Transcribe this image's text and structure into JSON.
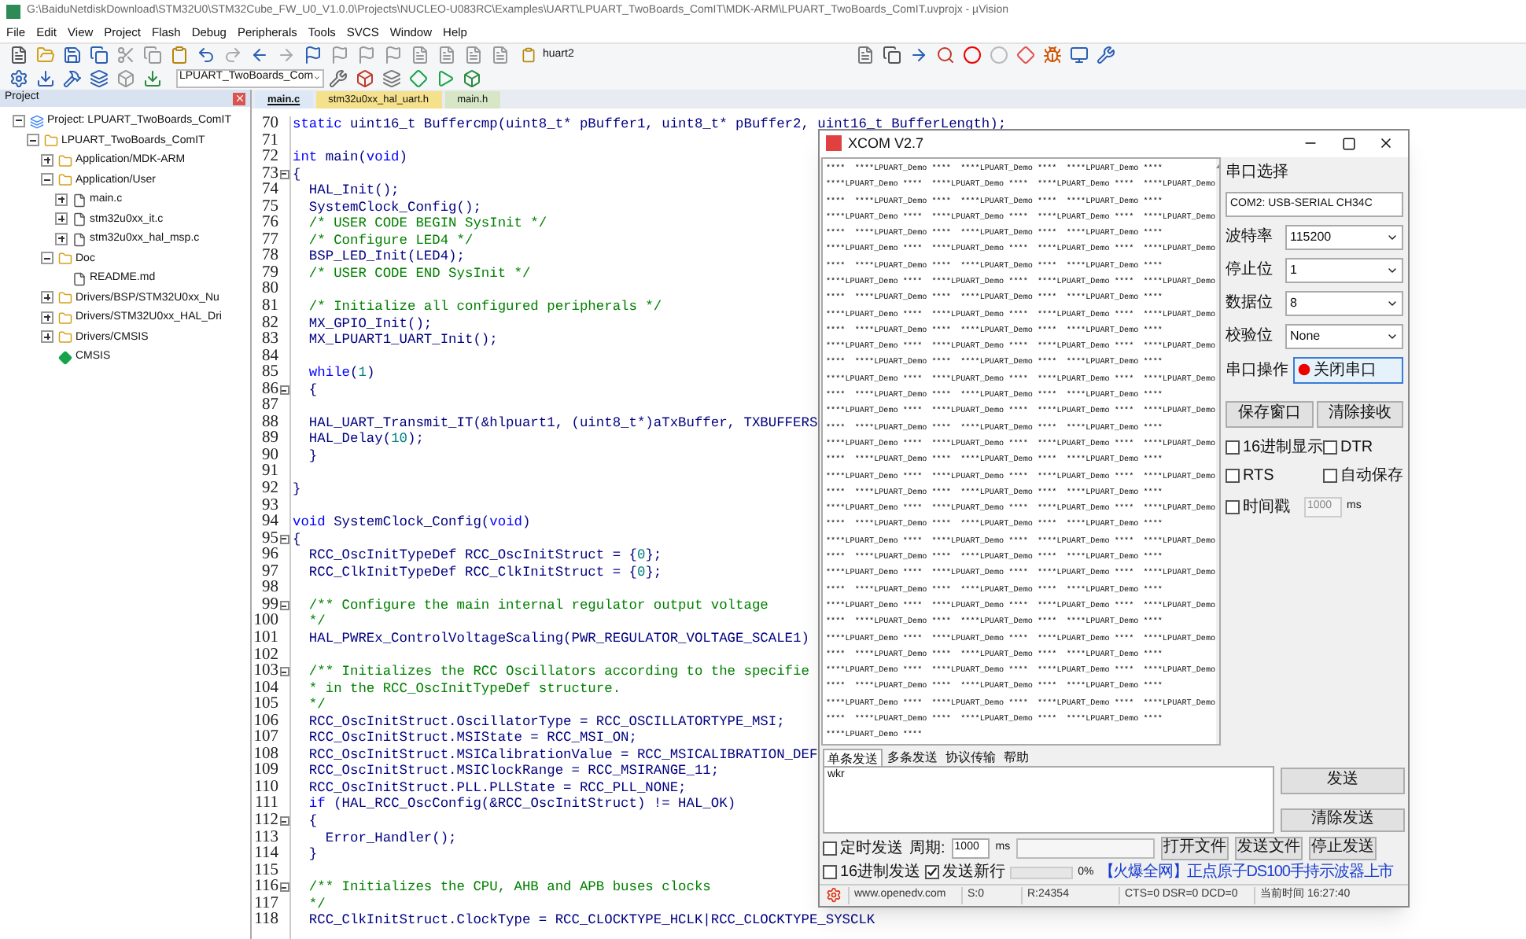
{
  "window": {
    "title": "G:\\BaiduNetdiskDownload\\STM32U0\\STM32Cube_FW_U0_V1.0.0\\Projects\\NUCLEO-U083RC\\Examples\\UART\\LPUART_TwoBoards_ComIT\\MDK-ARM\\LPUART_TwoBoards_ComIT.uvprojx - µVision"
  },
  "menu": [
    "File",
    "Edit",
    "View",
    "Project",
    "Flash",
    "Debug",
    "Peripherals",
    "Tools",
    "SVCS",
    "Window",
    "Help"
  ],
  "toolbar": {
    "find_value": "huart2",
    "target": "LPUART_TwoBoards_Com"
  },
  "project": {
    "title": "Project",
    "tree": [
      {
        "label": "Project: LPUART_TwoBoards_ComIT",
        "kind": "project",
        "expanded": true,
        "children": [
          {
            "label": "LPUART_TwoBoards_ComIT",
            "kind": "target",
            "expanded": true,
            "children": [
              {
                "label": "Application/MDK-ARM",
                "kind": "folder",
                "expanded": false
              },
              {
                "label": "Application/User",
                "kind": "folder",
                "expanded": true,
                "children": [
                  {
                    "label": "main.c",
                    "kind": "file",
                    "expanded": false
                  },
                  {
                    "label": "stm32u0xx_it.c",
                    "kind": "file",
                    "expanded": false
                  },
                  {
                    "label": "stm32u0xx_hal_msp.c",
                    "kind": "file",
                    "expanded": false
                  }
                ]
              },
              {
                "label": "Doc",
                "kind": "folder",
                "expanded": true,
                "children": [
                  {
                    "label": "README.md",
                    "kind": "file"
                  }
                ]
              },
              {
                "label": "Drivers/BSP/STM32U0xx_Nu",
                "kind": "folder",
                "expanded": false
              },
              {
                "label": "Drivers/STM32U0xx_HAL_Dri",
                "kind": "folder",
                "expanded": false
              },
              {
                "label": "Drivers/CMSIS",
                "kind": "folder",
                "expanded": false
              },
              {
                "label": "CMSIS",
                "kind": "component"
              }
            ]
          }
        ]
      }
    ]
  },
  "tabs": [
    {
      "label": "main.c",
      "selected": true,
      "color": "#dce8f5"
    },
    {
      "label": "stm32u0xx_hal_uart.h",
      "selected": false,
      "color": "#f5e08c"
    },
    {
      "label": "main.h",
      "selected": false,
      "color": "#d6e6c6"
    }
  ],
  "code": [
    {
      "n": "70",
      "parts": [
        {
          "kind": "keyword",
          "t": "static"
        },
        {
          "kind": "plain",
          "t": " uint16_t Buffercmp(uint8_t* pBuffer1, uint8_t* pBuffer2, uint16_t BufferLength);"
        }
      ]
    },
    {
      "n": "71"
    },
    {
      "n": "72",
      "parts": [
        {
          "kind": "keyword",
          "t": "int"
        },
        {
          "kind": "plain",
          "t": " main("
        },
        {
          "kind": "keyword",
          "t": "void"
        },
        {
          "kind": "plain",
          "t": ")"
        }
      ]
    },
    {
      "n": "73",
      "fold": true,
      "parts": [
        {
          "kind": "plain",
          "t": "{"
        }
      ]
    },
    {
      "n": "74",
      "parts": [
        {
          "kind": "plain",
          "t": "  HAL_Init();"
        }
      ]
    },
    {
      "n": "75",
      "parts": [
        {
          "kind": "plain",
          "t": "  SystemClock_Config();"
        }
      ]
    },
    {
      "n": "76",
      "parts": [
        {
          "kind": "comment",
          "t": "  /* USER CODE BEGIN SysInit */"
        }
      ]
    },
    {
      "n": "77",
      "parts": [
        {
          "kind": "comment",
          "t": "  /* Configure LED4 */"
        }
      ]
    },
    {
      "n": "78",
      "parts": [
        {
          "kind": "plain",
          "t": "  BSP_LED_Init(LED4);"
        }
      ]
    },
    {
      "n": "79",
      "parts": [
        {
          "kind": "comment",
          "t": "  /* USER CODE END SysInit */"
        }
      ]
    },
    {
      "n": "80"
    },
    {
      "n": "81",
      "parts": [
        {
          "kind": "comment",
          "t": "  /* Initialize all configured peripherals */"
        }
      ]
    },
    {
      "n": "82",
      "parts": [
        {
          "kind": "plain",
          "t": "  MX_GPIO_Init();"
        }
      ]
    },
    {
      "n": "83",
      "parts": [
        {
          "kind": "plain",
          "t": "  MX_LPUART1_UART_Init();"
        }
      ]
    },
    {
      "n": "84"
    },
    {
      "n": "85",
      "parts": [
        {
          "kind": "keyword",
          "t": "  while"
        },
        {
          "kind": "plain",
          "t": "("
        },
        {
          "kind": "number",
          "t": "1"
        },
        {
          "kind": "plain",
          "t": ")"
        }
      ]
    },
    {
      "n": "86",
      "fold": true,
      "parts": [
        {
          "kind": "plain",
          "t": "  {"
        }
      ]
    },
    {
      "n": "87"
    },
    {
      "n": "88",
      "parts": [
        {
          "kind": "plain",
          "t": "  HAL_UART_Transmit_IT(&hlpuart1, (uint8_t*)aTxBuffer, TXBUFFERS"
        }
      ]
    },
    {
      "n": "89",
      "parts": [
        {
          "kind": "plain",
          "t": "  HAL_Delay("
        },
        {
          "kind": "number",
          "t": "10"
        },
        {
          "kind": "plain",
          "t": ");"
        }
      ]
    },
    {
      "n": "90",
      "parts": [
        {
          "kind": "plain",
          "t": "  }"
        }
      ]
    },
    {
      "n": "91"
    },
    {
      "n": "92",
      "parts": [
        {
          "kind": "plain",
          "t": "}"
        }
      ]
    },
    {
      "n": "93"
    },
    {
      "n": "94",
      "parts": [
        {
          "kind": "keyword",
          "t": "void"
        },
        {
          "kind": "plain",
          "t": " SystemClock_Config("
        },
        {
          "kind": "keyword",
          "t": "void"
        },
        {
          "kind": "plain",
          "t": ")"
        }
      ]
    },
    {
      "n": "95",
      "fold": true,
      "parts": [
        {
          "kind": "plain",
          "t": "{"
        }
      ]
    },
    {
      "n": "96",
      "parts": [
        {
          "kind": "plain",
          "t": "  RCC_OscInitTypeDef RCC_OscInitStruct = {"
        },
        {
          "kind": "number",
          "t": "0"
        },
        {
          "kind": "plain",
          "t": "};"
        }
      ]
    },
    {
      "n": "97",
      "parts": [
        {
          "kind": "plain",
          "t": "  RCC_ClkInitTypeDef RCC_ClkInitStruct = {"
        },
        {
          "kind": "number",
          "t": "0"
        },
        {
          "kind": "plain",
          "t": "};"
        }
      ]
    },
    {
      "n": "98"
    },
    {
      "n": "99",
      "fold": true,
      "parts": [
        {
          "kind": "comment",
          "t": "  /** Configure the main internal regulator output voltage"
        }
      ]
    },
    {
      "n": "100",
      "parts": [
        {
          "kind": "comment",
          "t": "  */"
        }
      ]
    },
    {
      "n": "101",
      "parts": [
        {
          "kind": "plain",
          "t": "  HAL_PWREx_ControlVoltageScaling(PWR_REGULATOR_VOLTAGE_SCALE1)"
        }
      ]
    },
    {
      "n": "102"
    },
    {
      "n": "103",
      "fold": true,
      "parts": [
        {
          "kind": "comment",
          "t": "  /** Initializes the RCC Oscillators according to the specifie"
        }
      ]
    },
    {
      "n": "104",
      "parts": [
        {
          "kind": "comment",
          "t": "  * in the RCC_OscInitTypeDef structure."
        }
      ]
    },
    {
      "n": "105",
      "parts": [
        {
          "kind": "comment",
          "t": "  */"
        }
      ]
    },
    {
      "n": "106",
      "parts": [
        {
          "kind": "plain",
          "t": "  RCC_OscInitStruct.OscillatorType = RCC_OSCILLATORTYPE_MSI;"
        }
      ]
    },
    {
      "n": "107",
      "parts": [
        {
          "kind": "plain",
          "t": "  RCC_OscInitStruct.MSIState = RCC_MSI_ON;"
        }
      ]
    },
    {
      "n": "108",
      "parts": [
        {
          "kind": "plain",
          "t": "  RCC_OscInitStruct.MSICalibrationValue = RCC_MSICALIBRATION_DEF"
        }
      ]
    },
    {
      "n": "109",
      "parts": [
        {
          "kind": "plain",
          "t": "  RCC_OscInitStruct.MSIClockRange = RCC_MSIRANGE_11;"
        }
      ]
    },
    {
      "n": "110",
      "parts": [
        {
          "kind": "plain",
          "t": "  RCC_OscInitStruct.PLL.PLLState = RCC_PLL_NONE;"
        }
      ]
    },
    {
      "n": "111",
      "parts": [
        {
          "kind": "keyword",
          "t": "  if"
        },
        {
          "kind": "plain",
          "t": " (HAL_RCC_OscConfig(&RCC_OscInitStruct) != HAL_OK)"
        }
      ]
    },
    {
      "n": "112",
      "fold": true,
      "parts": [
        {
          "kind": "plain",
          "t": "  {"
        }
      ]
    },
    {
      "n": "113",
      "parts": [
        {
          "kind": "plain",
          "t": "    Error_Handler();"
        }
      ]
    },
    {
      "n": "114",
      "parts": [
        {
          "kind": "plain",
          "t": "  }"
        }
      ]
    },
    {
      "n": "115"
    },
    {
      "n": "116",
      "fold": true,
      "parts": [
        {
          "kind": "comment",
          "t": "  /** Initializes the CPU, AHB and APB buses clocks"
        }
      ]
    },
    {
      "n": "117",
      "parts": [
        {
          "kind": "comment",
          "t": "  */"
        }
      ]
    },
    {
      "n": "118",
      "parts": [
        {
          "kind": "plain",
          "t": "  RCC_ClkInitStruct.ClockType = RCC_CLOCKTYPE_HCLK|RCC_CLOCKTYPE_SYSCLK"
        }
      ]
    }
  ],
  "xcom": {
    "title": "XCOM V2.7",
    "receive": [
      "****  ****LPUART_Demo ****  ****LPUART_Demo ****  ****LPUART_Demo ****",
      "****LPUART_Demo ****  ****LPUART_Demo ****  ****LPUART_Demo ****  ****LPUART_Demo",
      "****  ****LPUART_Demo ****  ****LPUART_Demo ****  ****LPUART_Demo ****",
      "****LPUART_Demo ****  ****LPUART_Demo ****  ****LPUART_Demo ****  ****LPUART_Demo",
      "****  ****LPUART_Demo ****  ****LPUART_Demo ****  ****LPUART_Demo ****",
      "****LPUART_Demo ****  ****LPUART_Demo ****  ****LPUART_Demo ****  ****LPUART_Demo",
      "****  ****LPUART_Demo ****  ****LPUART_Demo ****  ****LPUART_Demo ****",
      "****LPUART_Demo ****  ****LPUART_Demo ****  ****LPUART_Demo ****  ****LPUART_Demo",
      "****  ****LPUART_Demo ****  ****LPUART_Demo ****  ****LPUART_Demo ****",
      "****LPUART_Demo ****  ****LPUART_Demo ****  ****LPUART_Demo ****  ****LPUART_Demo",
      "****  ****LPUART_Demo ****  ****LPUART_Demo ****  ****LPUART_Demo ****",
      "****LPUART_Demo ****  ****LPUART_Demo ****  ****LPUART_Demo ****  ****LPUART_Demo",
      "****  ****LPUART_Demo ****  ****LPUART_Demo ****  ****LPUART_Demo ****",
      "****LPUART_Demo ****  ****LPUART_Demo ****  ****LPUART_Demo ****  ****LPUART_Demo",
      "****  ****LPUART_Demo ****  ****LPUART_Demo ****  ****LPUART_Demo ****",
      "****LPUART_Demo ****  ****LPUART_Demo ****  ****LPUART_Demo ****  ****LPUART_Demo",
      "****  ****LPUART_Demo ****  ****LPUART_Demo ****  ****LPUART_Demo ****",
      "****LPUART_Demo ****  ****LPUART_Demo ****  ****LPUART_Demo ****  ****LPUART_Demo",
      "****  ****LPUART_Demo ****  ****LPUART_Demo ****  ****LPUART_Demo ****",
      "****LPUART_Demo ****  ****LPUART_Demo ****  ****LPUART_Demo ****  ****LPUART_Demo",
      "****  ****LPUART_Demo ****  ****LPUART_Demo ****  ****LPUART_Demo ****",
      "****LPUART_Demo ****  ****LPUART_Demo ****  ****LPUART_Demo ****  ****LPUART_Demo",
      "****  ****LPUART_Demo ****  ****LPUART_Demo ****  ****LPUART_Demo ****",
      "****LPUART_Demo ****  ****LPUART_Demo ****  ****LPUART_Demo ****  ****LPUART_Demo",
      "****  ****LPUART_Demo ****  ****LPUART_Demo ****  ****LPUART_Demo ****",
      "****LPUART_Demo ****  ****LPUART_Demo ****  ****LPUART_Demo ****  ****LPUART_Demo",
      "****  ****LPUART_Demo ****  ****LPUART_Demo ****  ****LPUART_Demo ****",
      "****LPUART_Demo ****  ****LPUART_Demo ****  ****LPUART_Demo ****  ****LPUART_Demo",
      "****  ****LPUART_Demo ****  ****LPUART_Demo ****  ****LPUART_Demo ****",
      "****LPUART_Demo ****  ****LPUART_Demo ****  ****LPUART_Demo ****  ****LPUART_Demo",
      "****  ****LPUART_Demo ****  ****LPUART_Demo ****  ****LPUART_Demo ****",
      "****LPUART_Demo ****  ****LPUART_Demo ****  ****LPUART_Demo ****  ****LPUART_Demo",
      "****  ****LPUART_Demo ****  ****LPUART_Demo ****  ****LPUART_Demo ****",
      "****LPUART_Demo ****  ****LPUART_Demo ****  ****LPUART_Demo ****  ****LPUART_Demo",
      "****  ****LPUART_Demo ****  ****LPUART_Demo ****  ****LPUART_Demo ****",
      "****LPUART_Demo ****"
    ],
    "port_label": "串口选择",
    "port": "COM2: USB-SERIAL CH34C",
    "settings": [
      {
        "label": "波特率",
        "value": "115200"
      },
      {
        "label": "停止位",
        "value": "1"
      },
      {
        "label": "数据位",
        "value": "8"
      },
      {
        "label": "校验位",
        "value": "None"
      }
    ],
    "op_label": "串口操作",
    "op_button": "关闭串口",
    "save_button": "保存窗口",
    "clear_button": "清除接收",
    "options": [
      {
        "label": "16进制显示",
        "checked": false
      },
      {
        "label": "DTR",
        "checked": false
      },
      {
        "label": "RTS",
        "checked": false
      },
      {
        "label": "自动保存",
        "checked": false
      }
    ],
    "timestamp": {
      "label": "时间戳",
      "checked": false,
      "placeholder": "1000",
      "unit": "ms"
    },
    "send_tabs": [
      {
        "label": "单条发送",
        "selected": true
      },
      {
        "label": "多条发送",
        "selected": false
      },
      {
        "label": "协议传输",
        "selected": false
      },
      {
        "label": "帮助",
        "selected": false
      }
    ],
    "send_text": "wkr",
    "send_button": "发送",
    "clear_send_button": "清除发送",
    "timed_send": {
      "label": "定时发送",
      "checked": false
    },
    "period_label": "周期:",
    "period": "1000",
    "period_unit": "ms",
    "file_buttons": [
      "打开文件",
      "发送文件",
      "停止发送"
    ],
    "hex_send": {
      "label": "16进制发送",
      "checked": false
    },
    "newline": {
      "label": "发送新行",
      "checked": true
    },
    "progress": {
      "level": 0,
      "reading": "0%"
    },
    "ad": "【火爆全网】正点原子DS100手持示波器上市",
    "status": [
      "www.openedv.com",
      "S:0",
      "R:24354",
      "CTS=0 DSR=0 DCD=0",
      "当前时间 16:27:40"
    ]
  }
}
